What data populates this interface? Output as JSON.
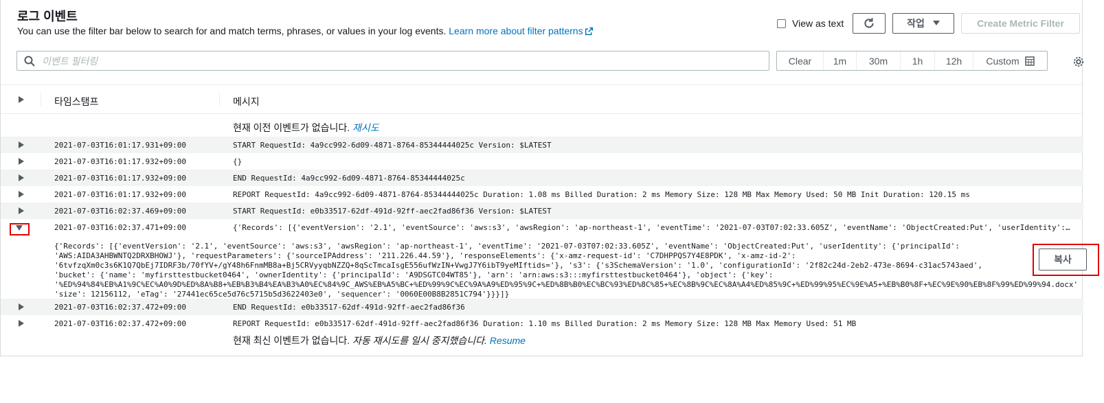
{
  "header": {
    "title": "로그 이벤트",
    "description": "You can use the filter bar below to search for and match terms, phrases, or values in your log events.",
    "learn_more": "Learn more about filter patterns",
    "view_as_text": "View as text",
    "actions_label": "작업",
    "create_metric_filter": "Create Metric Filter"
  },
  "filter": {
    "placeholder": "이벤트 필터링",
    "value": ""
  },
  "time_range": {
    "clear": "Clear",
    "options": [
      "1m",
      "30m",
      "1h",
      "12h"
    ],
    "custom": "Custom"
  },
  "table": {
    "col_timestamp": "타임스탬프",
    "col_message": "메시지"
  },
  "notices": {
    "top_text": "현재 이전 이벤트가 없습니다.",
    "top_link": "재시도",
    "bottom_text": "현재 최신 이벤트가 없습니다.",
    "bottom_italic": "자동 재시도를 일시 중지했습니다.",
    "bottom_link": "Resume"
  },
  "rows": [
    {
      "timestamp": "2021-07-03T16:01:17.931+09:00",
      "message": "START RequestId: 4a9cc992-6d09-4871-8764-85344444025c Version: $LATEST"
    },
    {
      "timestamp": "2021-07-03T16:01:17.932+09:00",
      "message": "{}"
    },
    {
      "timestamp": "2021-07-03T16:01:17.932+09:00",
      "message": "END RequestId: 4a9cc992-6d09-4871-8764-85344444025c"
    },
    {
      "timestamp": "2021-07-03T16:01:17.932+09:00",
      "message": "REPORT RequestId: 4a9cc992-6d09-4871-8764-85344444025c Duration: 1.08 ms Billed Duration: 2 ms Memory Size: 128 MB Max Memory Used: 50 MB Init Duration: 120.15 ms"
    },
    {
      "timestamp": "2021-07-03T16:02:37.469+09:00",
      "message": "START RequestId: e0b33517-62df-491d-92ff-aec2fad86f36 Version: $LATEST"
    },
    {
      "timestamp": "2021-07-03T16:02:37.471+09:00",
      "message": "{'Records': [{'eventVersion': '2.1', 'eventSource': 'aws:s3', 'awsRegion': 'ap-northeast-1', 'eventTime': '2021-07-03T07:02:33.605Z', 'eventName': 'ObjectCreated:Put', 'userIdentity': {'principalId': 'AWS:AIDA3AHBWNTQ2DRXBHOWJ'}, ...}]}"
    },
    {
      "timestamp": "2021-07-03T16:02:37.472+09:00",
      "message": "END RequestId: e0b33517-62df-491d-92ff-aec2fad86f36"
    },
    {
      "timestamp": "2021-07-03T16:02:37.472+09:00",
      "message": "REPORT RequestId: e0b33517-62df-491d-92ff-aec2fad86f36 Duration: 1.10 ms Billed Duration: 2 ms Memory Size: 128 MB Max Memory Used: 51 MB"
    }
  ],
  "expanded": {
    "message": "{'Records': [{'eventVersion': '2.1', 'eventSource': 'aws:s3', 'awsRegion': 'ap-northeast-1', 'eventTime': '2021-07-03T07:02:33.605Z', 'eventName': 'ObjectCreated:Put', 'userIdentity': {'principalId':\n'AWS:AIDA3AHBWNTQ2DRXBHOWJ'}, 'requestParameters': {'sourceIPAddress': '211.226.44.59'}, 'responseElements': {'x-amz-request-id': 'C7DHPPQS7Y4E8PDK', 'x-amz-id-2':\n'6tvfzqXm0c3s6K1Q7QbEj7IDRF3b/70fYV+/gY48h6FnmMB8a+Bj5CRVyyqbNZZQ+8qScTmcaIsgE556ufWzIN+VwgJ7Y6ibT9yeMIftids='}, 's3': {'s3SchemaVersion': '1.0', 'configurationId': '2f82c24d-2eb2-473e-8694-c31ac5743aed',\n'bucket': {'name': 'myfirsttestbucket0464', 'ownerIdentity': {'principalId': 'A9DSGTC04WT85'}, 'arn': 'arn:aws:s3:::myfirsttestbucket0464'}, 'object': {'key':\n'%ED%94%84%EB%A1%9C%EC%A0%9D%ED%8A%B8+%EB%B3%B4%EA%B3%A0%EC%84%9C_AWS%EB%A5%BC+%ED%99%9C%EC%9A%A9%ED%95%9C+%ED%8B%B0%EC%BC%93%ED%8C%85+%EC%8B%9C%EC%8A%A4%ED%85%9C+%ED%99%95%EC%9E%A5+%EB%B0%8F+%EC%9E%90%EB%8F%99%ED%99%94.docx',\n'size': 12156112, 'eTag': '27441ec65ce5d76c5715b5d3622403e0', 'sequencer': '0060E00B8B2851C794'}}}]}",
    "copy_label": "복사"
  }
}
